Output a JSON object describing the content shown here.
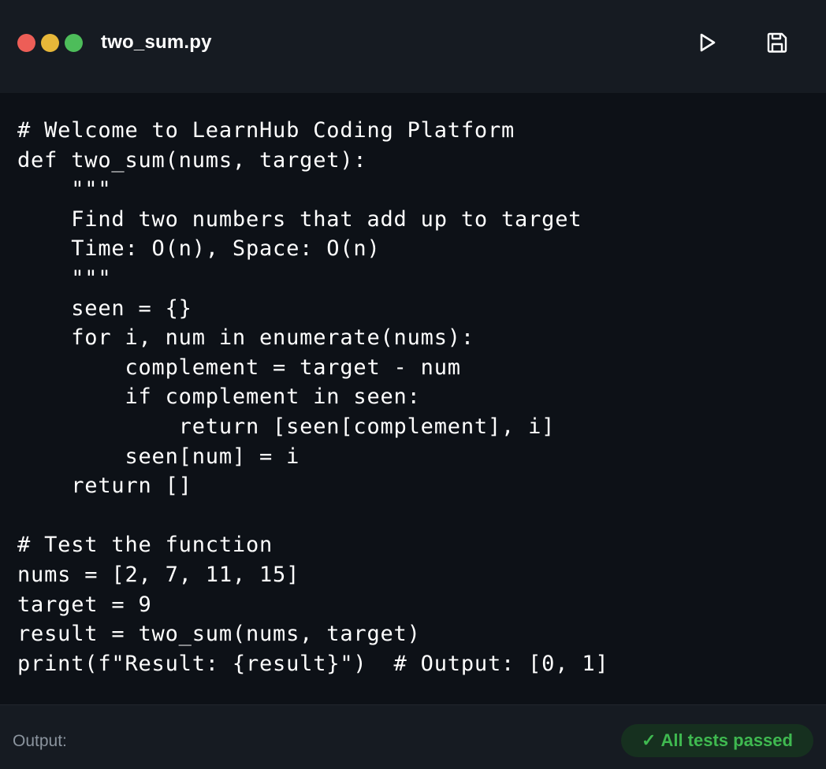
{
  "window": {
    "filename": "two_sum.py",
    "controls": [
      "close",
      "minimize",
      "maximize"
    ]
  },
  "toolbar": {
    "run_icon": "play-icon",
    "save_icon": "save-icon"
  },
  "editor": {
    "lines": [
      "# Welcome to LearnHub Coding Platform",
      "def two_sum(nums, target):",
      "    \"\"\"",
      "    Find two numbers that add up to target",
      "    Time: O(n), Space: O(n)",
      "    \"\"\"",
      "    seen = {}",
      "    for i, num in enumerate(nums):",
      "        complement = target - num",
      "        if complement in seen:",
      "            return [seen[complement], i]",
      "        seen[num] = i",
      "    return []",
      "",
      "# Test the function",
      "nums = [2, 7, 11, 15]",
      "target = 9",
      "result = two_sum(nums, target)",
      "print(f\"Result: {result}\")  # Output: [0, 1]"
    ]
  },
  "footer": {
    "output_label": "Output:",
    "status_check": "✓",
    "status_text": "All tests passed"
  },
  "colors": {
    "background": "#0d1117",
    "panel": "#161b22",
    "success": "#3fb950",
    "close": "#ed5e57",
    "minimize": "#e7b739",
    "maximize": "#4dbd5a"
  }
}
